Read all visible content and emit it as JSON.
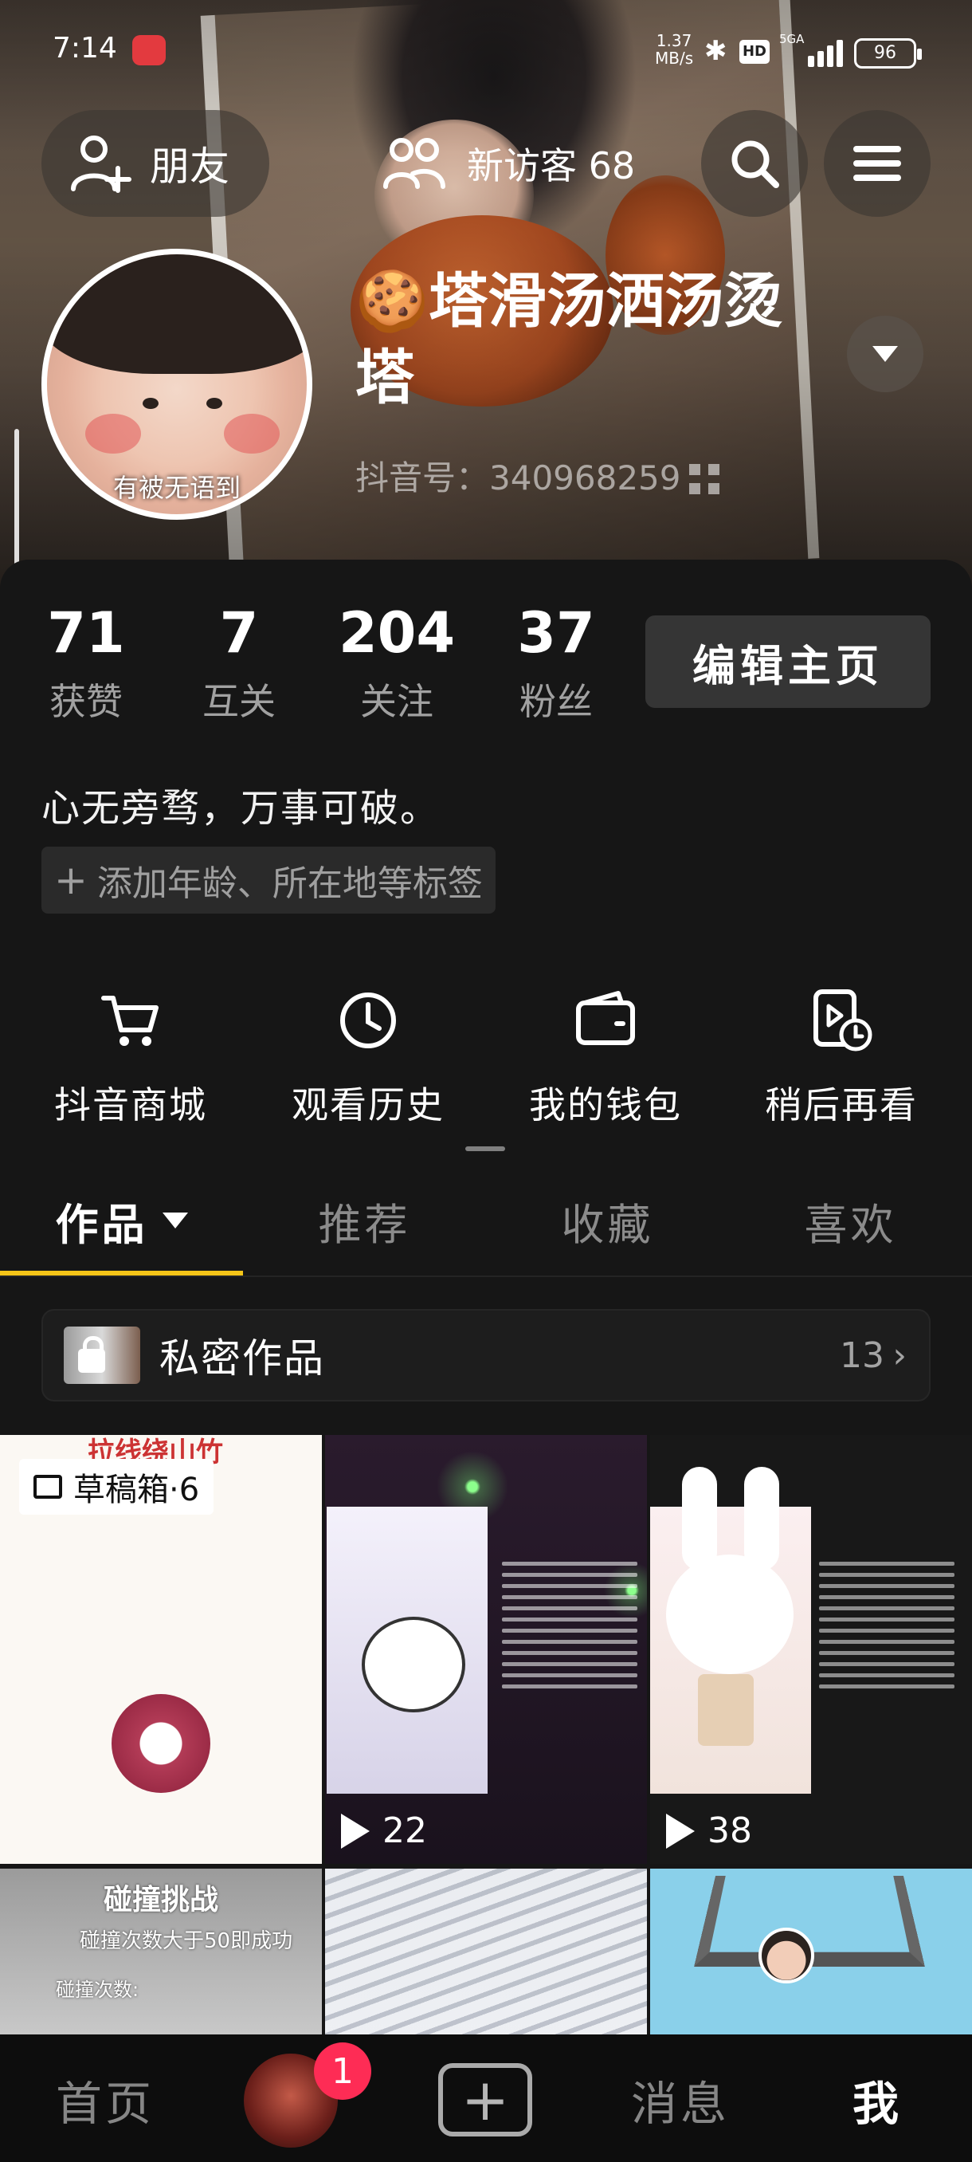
{
  "status_bar": {
    "time": "7:14",
    "net_speed": "1.37",
    "net_unit": "MB/s",
    "hd_label": "HD",
    "signal_label": "5GA",
    "battery": "96",
    "icons": [
      "app-notification-icon",
      "bluetooth-icon",
      "hd-icon",
      "signal-icon",
      "battery-icon"
    ]
  },
  "header": {
    "friends_label": "朋友",
    "visitors_label": "新访客 68",
    "icons": [
      "add-friend-icon",
      "visitors-icon",
      "search-icon",
      "menu-icon"
    ]
  },
  "profile": {
    "avatar_caption": "有被无语到",
    "nickname": "🍪塔滑汤洒汤烫塔",
    "douyin_id": "抖音号：340968259",
    "edit_label": "编辑主页",
    "bio": "心无旁骛，万事可破。",
    "add_tag_label": "添加年龄、所在地等标签",
    "stats": [
      {
        "num": "71",
        "label": "获赞"
      },
      {
        "num": "7",
        "label": "互关"
      },
      {
        "num": "204",
        "label": "关注"
      },
      {
        "num": "37",
        "label": "粉丝"
      }
    ]
  },
  "shortcuts": [
    {
      "label": "抖音商城",
      "icon": "cart-icon"
    },
    {
      "label": "观看历史",
      "icon": "clock-icon"
    },
    {
      "label": "我的钱包",
      "icon": "wallet-icon"
    },
    {
      "label": "稍后再看",
      "icon": "watch-later-icon"
    }
  ],
  "tabs": [
    {
      "label": "作品"
    },
    {
      "label": "推荐"
    },
    {
      "label": "收藏"
    },
    {
      "label": "喜欢"
    }
  ],
  "private_works": {
    "label": "私密作品",
    "count": "13"
  },
  "grid": {
    "drafts_label": "草稿箱·6",
    "c1_top_text": "拉线绕山竹",
    "items": [
      {
        "plays": "22"
      },
      {
        "plays": "38"
      }
    ],
    "c4_title": "碰撞挑战",
    "c4_sub": "碰撞次数大于50即成功",
    "c4_sub2": "碰撞次数:"
  },
  "bottom_nav": {
    "home": "首页",
    "badge": "1",
    "messages": "消息",
    "me": "我"
  },
  "colors": {
    "accent": "#f5c518",
    "badge": "#fe2c55",
    "background": "#161616"
  }
}
